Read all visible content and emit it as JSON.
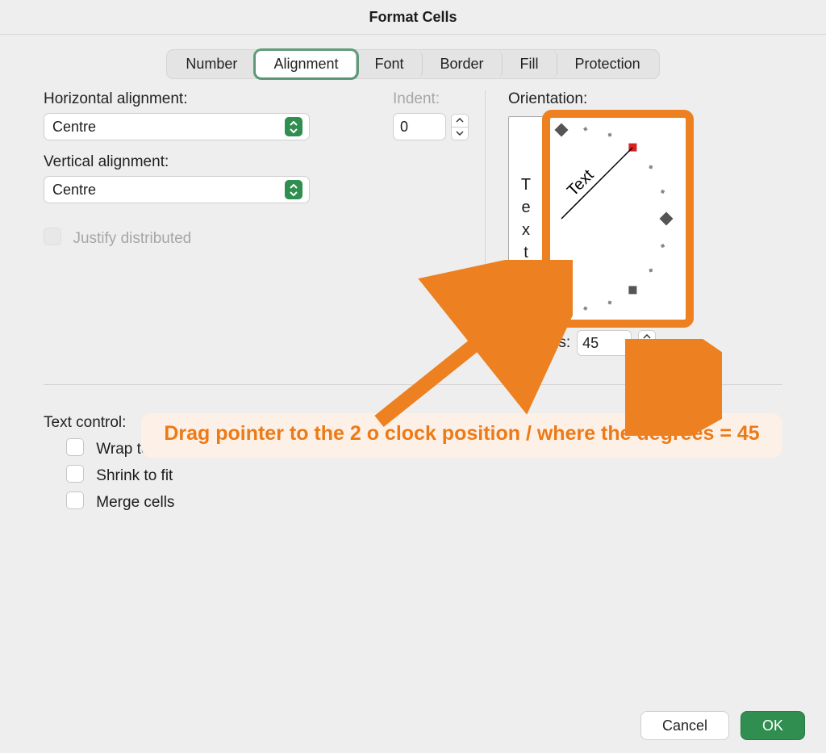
{
  "title": "Format Cells",
  "tabs": [
    "Number",
    "Alignment",
    "Font",
    "Border",
    "Fill",
    "Protection"
  ],
  "active_tab": "Alignment",
  "labels": {
    "h_align": "Horizontal alignment:",
    "indent": "Indent:",
    "v_align": "Vertical alignment:",
    "justify": "Justify distributed",
    "orientation": "Orientation:",
    "degrees": "Degrees:",
    "text_control": "Text control:",
    "wrap": "Wrap text",
    "shrink": "Shrink to fit",
    "merge": "Merge cells"
  },
  "values": {
    "h_align": "Centre",
    "v_align": "Centre",
    "indent": "0",
    "degrees": "45",
    "vertical_text_glyphs": [
      "T",
      "e",
      "x",
      "t"
    ],
    "dial_label": "Text"
  },
  "buttons": {
    "cancel": "Cancel",
    "ok": "OK"
  },
  "annotation": "Drag pointer to the 2 o clock position / where the degrees = 45",
  "colors": {
    "accent": "#2f8e50",
    "annotation": "#ed7a16",
    "highlight": "#ed8121"
  }
}
